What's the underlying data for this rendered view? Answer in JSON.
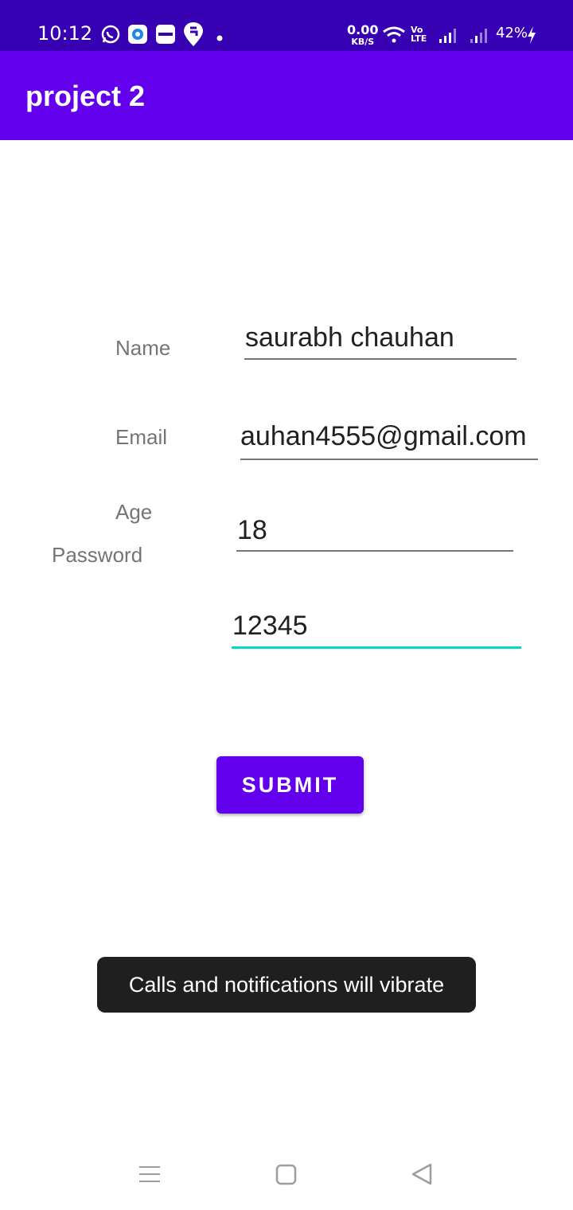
{
  "status_bar": {
    "time": "10:12",
    "net_speed_value": "0.00",
    "net_speed_unit": "KB/S",
    "volte": "Vo LTE",
    "battery": "42%",
    "icons": [
      "whatsapp-icon",
      "signal-app-icon",
      "paytm-icon",
      "swiggy-icon",
      "wifi-icon",
      "cell-signal-icon",
      "battery-charging-icon"
    ]
  },
  "app_bar": {
    "title": "project 2"
  },
  "form": {
    "name_label": "Name",
    "name_value": "saurabh chauhan",
    "email_label": "Email",
    "email_value": "auhan4555@gmail.com",
    "age_label": "Age",
    "age_value": "18",
    "password_label": "Password",
    "password_value": "12345",
    "submit_label": "SUBMIT"
  },
  "toast": {
    "text": "Calls and notifications will vibrate"
  },
  "nav_bar": {
    "icons": [
      "menu-icon",
      "home-icon",
      "back-icon"
    ]
  },
  "colors": {
    "primary": "#6200ee",
    "primary_dark": "#3700b3",
    "accent": "#03dac5"
  }
}
